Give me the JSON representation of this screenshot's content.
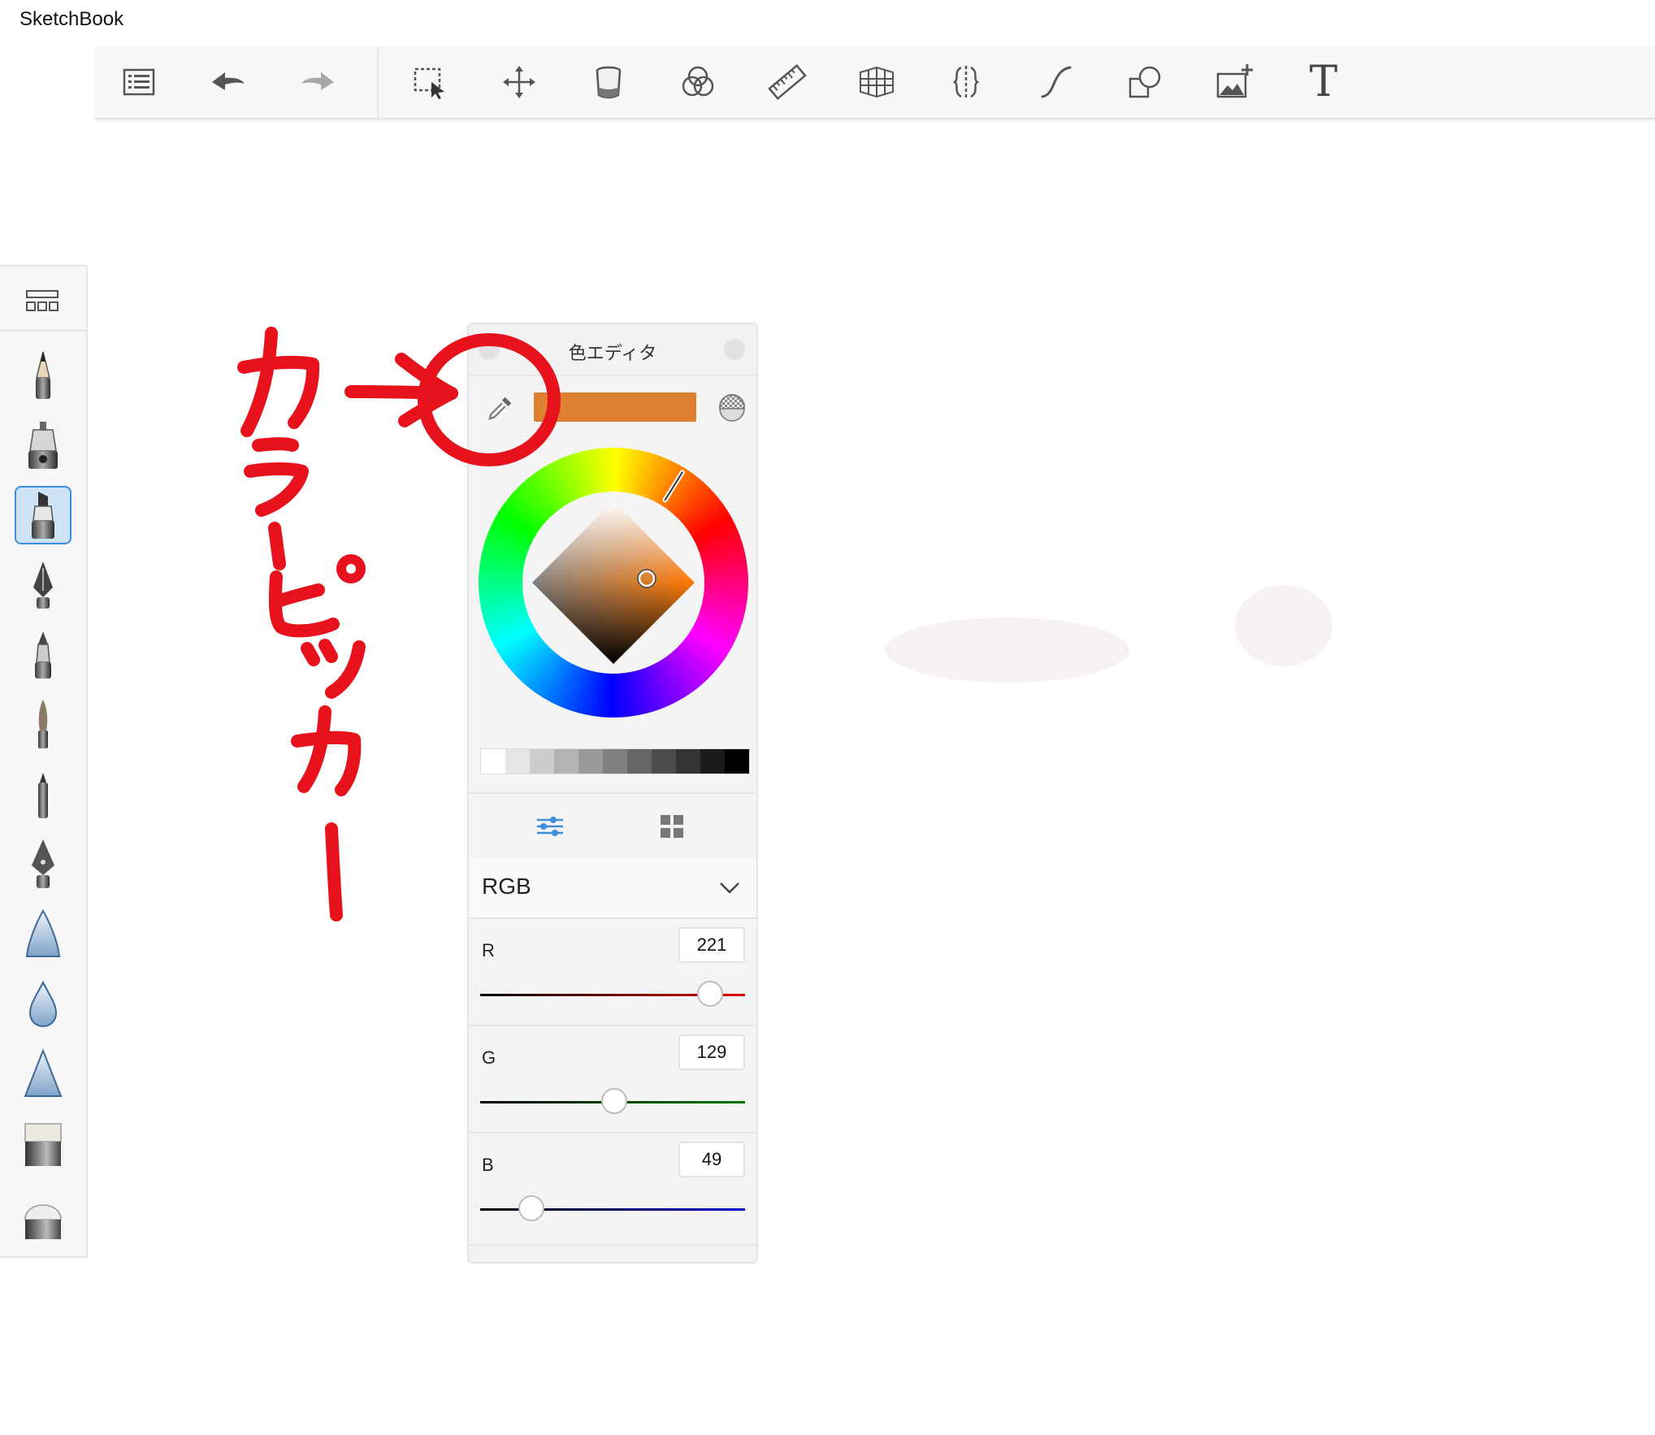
{
  "app": {
    "title": "SketchBook"
  },
  "toolbar": {
    "items": [
      {
        "name": "list-menu",
        "icon": "list-icon"
      },
      {
        "name": "undo",
        "icon": "undo-arrow-icon"
      },
      {
        "name": "redo",
        "icon": "redo-arrow-icon"
      },
      {
        "name": "selection",
        "icon": "marquee-select-icon"
      },
      {
        "name": "transform",
        "icon": "move-arrows-icon"
      },
      {
        "name": "fill",
        "icon": "paint-bucket-icon"
      },
      {
        "name": "blend",
        "icon": "color-circles-icon"
      },
      {
        "name": "ruler",
        "icon": "ruler-icon"
      },
      {
        "name": "perspective",
        "icon": "perspective-grid-icon"
      },
      {
        "name": "symmetry",
        "icon": "symmetry-icon"
      },
      {
        "name": "stroke",
        "icon": "stroke-curve-icon"
      },
      {
        "name": "shapes",
        "icon": "shapes-icon"
      },
      {
        "name": "add-image",
        "icon": "add-image-icon"
      },
      {
        "name": "text",
        "icon": "text-icon",
        "glyph": "T"
      }
    ]
  },
  "brushes": {
    "selected_index": 2,
    "items": [
      "pencil",
      "airbrush",
      "marker",
      "ink-pen",
      "ballpoint",
      "paint-brush",
      "felt-pen",
      "calligraphy-pen",
      "smudge",
      "blur",
      "sharpen",
      "hard-eraser",
      "soft-eraser"
    ]
  },
  "color_editor": {
    "title": "色エディタ",
    "current_color": "#DD8131",
    "hue_degrees": 28,
    "grays": [
      "#ffffff",
      "#e6e6e6",
      "#cccccc",
      "#b3b3b3",
      "#999999",
      "#808080",
      "#666666",
      "#4d4d4d",
      "#333333",
      "#1a1a1a",
      "#000000"
    ],
    "model": "RGB",
    "channels": [
      {
        "label": "R",
        "value": "221",
        "max": 255,
        "color": "#dd0000"
      },
      {
        "label": "G",
        "value": "129",
        "max": 255,
        "color": "#007a00"
      },
      {
        "label": "B",
        "value": "49",
        "max": 255,
        "color": "#0000cc"
      }
    ]
  },
  "annotation": {
    "text_chars": [
      "カ",
      "ラ",
      "ー",
      "ピ",
      "ッ",
      "カ",
      "ー"
    ],
    "color": "#e8121c"
  }
}
